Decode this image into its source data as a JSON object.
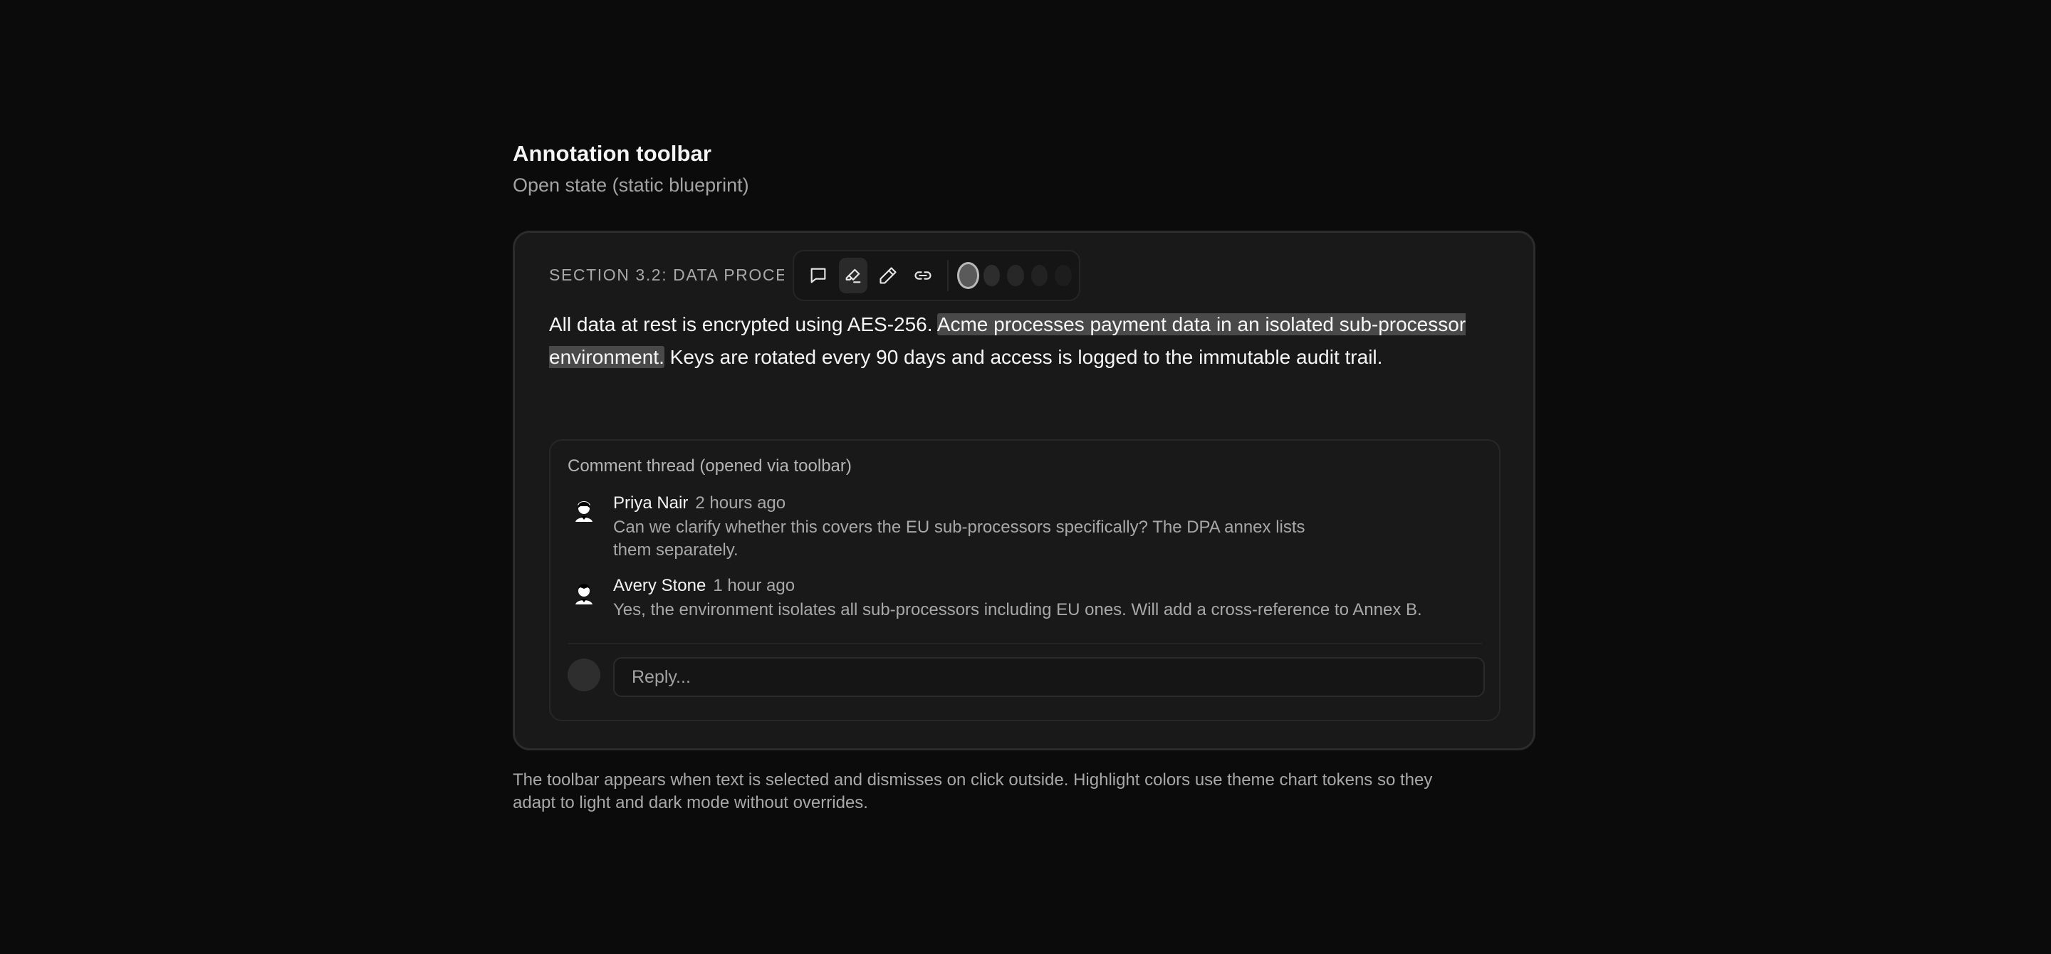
{
  "header": {
    "title": "Annotation toolbar",
    "subtitle": "Open state (static blueprint)"
  },
  "document": {
    "section_label": "SECTION 3.2: DATA PROCESSING",
    "text_before": "All data at rest is encrypted using AES-256. ",
    "text_highlight": "Acme processes payment data in an isolated sub-processor environment.",
    "text_after": " Keys are rotated every 90 days and access is logged to the immutable audit trail."
  },
  "toolbar": {
    "tools": [
      {
        "icon": "comment-icon",
        "active": false
      },
      {
        "icon": "highlighter-icon",
        "active": true
      },
      {
        "icon": "pencil-icon",
        "active": false
      },
      {
        "icon": "link-icon",
        "active": false
      }
    ],
    "swatches": [
      {
        "color": "#5a5a5a",
        "selected": true
      },
      {
        "color": "#2d2d2d",
        "selected": false
      },
      {
        "color": "#272727",
        "selected": false
      },
      {
        "color": "#222222",
        "selected": false
      },
      {
        "color": "#1d1d1d",
        "selected": false
      }
    ]
  },
  "thread": {
    "title": "Comment thread (opened via toolbar)",
    "comments": [
      {
        "author": "Priya Nair",
        "time": "2 hours ago",
        "body_line1": "Can we clarify whether this covers the EU sub-processors specifically? The DPA annex lists",
        "body_line2": "them separately."
      },
      {
        "author": "Avery Stone",
        "time": "1 hour ago",
        "body_line1": "Yes, the environment isolates all sub-processors including EU ones. Will add a cross-reference to Annex B."
      }
    ],
    "reply_placeholder": "Reply..."
  },
  "footnote": {
    "line1": "The toolbar appears when text is selected and dismisses on click outside. Highlight colors use theme chart tokens so they",
    "line2": "adapt to light and dark mode without overrides."
  }
}
